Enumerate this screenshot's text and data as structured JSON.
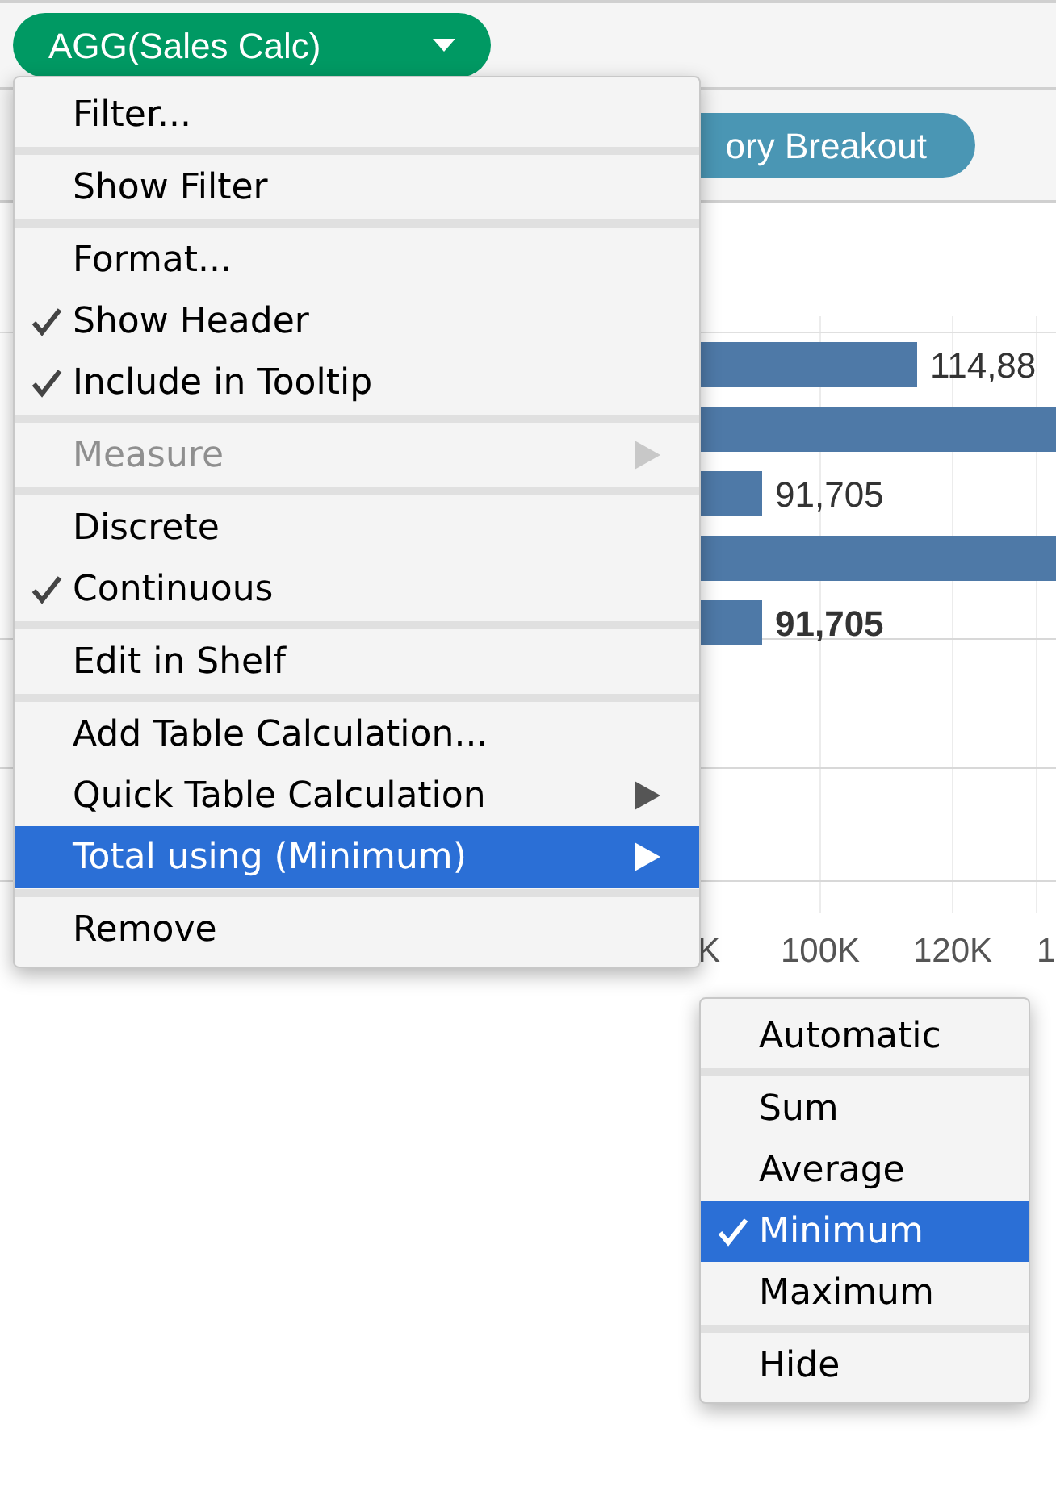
{
  "shelves": [
    {
      "label": "AGG(Sales Calc)",
      "color": "#009963",
      "dropdown": true
    },
    {
      "label": "ory Breakout",
      "color": "#4a96b4",
      "dropdown": false
    }
  ],
  "chart": {
    "value_labels": [
      {
        "text": "114,88",
        "bold": false
      },
      {
        "text": "91,705",
        "bold": false
      },
      {
        "text": "91,705",
        "bold": true
      }
    ],
    "axis_labels": [
      "K",
      "100K",
      "120K",
      "1"
    ]
  },
  "menu": {
    "items": [
      {
        "kind": "item",
        "label": "Filter...",
        "checked": false,
        "disabled": false,
        "submenu": false,
        "selected": false
      },
      {
        "kind": "separator"
      },
      {
        "kind": "item",
        "label": "Show Filter",
        "checked": false,
        "disabled": false,
        "submenu": false,
        "selected": false
      },
      {
        "kind": "separator"
      },
      {
        "kind": "item",
        "label": "Format...",
        "checked": false,
        "disabled": false,
        "submenu": false,
        "selected": false
      },
      {
        "kind": "item",
        "label": "Show Header",
        "checked": true,
        "disabled": false,
        "submenu": false,
        "selected": false
      },
      {
        "kind": "item",
        "label": "Include in Tooltip",
        "checked": true,
        "disabled": false,
        "submenu": false,
        "selected": false
      },
      {
        "kind": "separator"
      },
      {
        "kind": "item",
        "label": "Measure",
        "checked": false,
        "disabled": true,
        "submenu": true,
        "selected": false
      },
      {
        "kind": "separator"
      },
      {
        "kind": "item",
        "label": "Discrete",
        "checked": false,
        "disabled": false,
        "submenu": false,
        "selected": false
      },
      {
        "kind": "item",
        "label": "Continuous",
        "checked": true,
        "disabled": false,
        "submenu": false,
        "selected": false
      },
      {
        "kind": "separator"
      },
      {
        "kind": "item",
        "label": "Edit in Shelf",
        "checked": false,
        "disabled": false,
        "submenu": false,
        "selected": false
      },
      {
        "kind": "separator"
      },
      {
        "kind": "item",
        "label": "Add Table Calculation...",
        "checked": false,
        "disabled": false,
        "submenu": false,
        "selected": false
      },
      {
        "kind": "item",
        "label": "Quick Table Calculation",
        "checked": false,
        "disabled": false,
        "submenu": true,
        "selected": false
      },
      {
        "kind": "item",
        "label": "Total using (Minimum)",
        "checked": false,
        "disabled": false,
        "submenu": true,
        "selected": true
      },
      {
        "kind": "separator"
      },
      {
        "kind": "item",
        "label": "Remove",
        "checked": false,
        "disabled": false,
        "submenu": false,
        "selected": false
      }
    ]
  },
  "submenu": {
    "items": [
      {
        "kind": "item",
        "label": "Automatic",
        "checked": false,
        "disabled": false,
        "submenu": false,
        "selected": false
      },
      {
        "kind": "separator"
      },
      {
        "kind": "item",
        "label": "Sum",
        "checked": false,
        "disabled": false,
        "submenu": false,
        "selected": false
      },
      {
        "kind": "item",
        "label": "Average",
        "checked": false,
        "disabled": false,
        "submenu": false,
        "selected": false
      },
      {
        "kind": "item",
        "label": "Minimum",
        "checked": true,
        "disabled": false,
        "submenu": false,
        "selected": true
      },
      {
        "kind": "item",
        "label": "Maximum",
        "checked": false,
        "disabled": false,
        "submenu": false,
        "selected": false
      },
      {
        "kind": "separator"
      },
      {
        "kind": "item",
        "label": "Hide",
        "checked": false,
        "disabled": false,
        "submenu": false,
        "selected": false
      }
    ]
  }
}
